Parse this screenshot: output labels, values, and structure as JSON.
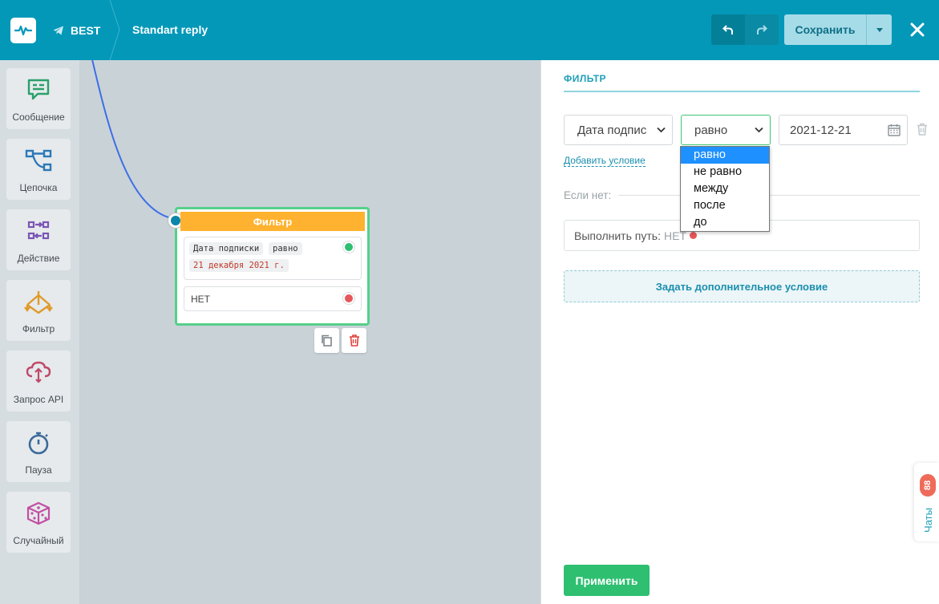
{
  "header": {
    "bot_name": "BEST",
    "flow_title": "Standart reply",
    "save_label": "Сохранить"
  },
  "toolbar": {
    "items": [
      {
        "label": "Сообщение",
        "icon": "message-icon",
        "color": "#2aa06a"
      },
      {
        "label": "Цепочка",
        "icon": "chain-icon",
        "color": "#2b78b8"
      },
      {
        "label": "Действие",
        "icon": "action-icon",
        "color": "#7a55b5"
      },
      {
        "label": "Фильтр",
        "icon": "filter-icon",
        "color": "#e09a2a"
      },
      {
        "label": "Запрос API",
        "icon": "api-cloud-icon",
        "color": "#c0496a"
      },
      {
        "label": "Пауза",
        "icon": "stopwatch-icon",
        "color": "#3c6a9a"
      },
      {
        "label": "Случайный",
        "icon": "dice-icon",
        "color": "#c24fa2"
      }
    ]
  },
  "node": {
    "title": "Фильтр",
    "condition_field": "Дата подписки",
    "condition_op": "равно",
    "condition_value": "21 декабря 2021 г.",
    "else_label": "НЕТ"
  },
  "panel": {
    "title": "ФИЛЬТР",
    "field_select": "Дата подпис",
    "operator_select": "равно",
    "date_value": "2021-12-21",
    "add_condition": "Добавить условие",
    "else_label": "Если нет:",
    "path_label": "Выполнить путь:",
    "path_value": "НЕТ",
    "more_condition": "Задать дополнительное условие",
    "apply": "Применить"
  },
  "dropdown": {
    "options": [
      "равно",
      "не равно",
      "между",
      "после",
      "до"
    ],
    "selected": "равно"
  },
  "chats": {
    "label": "Чаты",
    "count": "88"
  },
  "colors": {
    "header": "#0398b8",
    "accent_green": "#2fbf71",
    "filter_orange": "#ffb22f",
    "link_blue": "#1b8fae"
  }
}
